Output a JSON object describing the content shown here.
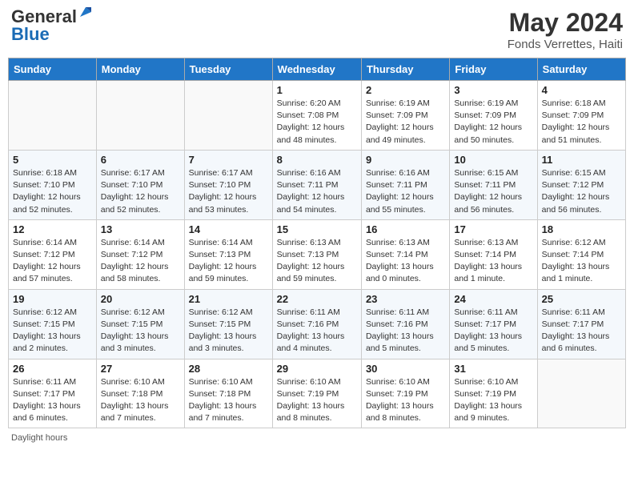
{
  "logo": {
    "general": "General",
    "blue": "Blue"
  },
  "header": {
    "month": "May 2024",
    "location": "Fonds Verrettes, Haiti"
  },
  "weekdays": [
    "Sunday",
    "Monday",
    "Tuesday",
    "Wednesday",
    "Thursday",
    "Friday",
    "Saturday"
  ],
  "weeks": [
    [
      {
        "day": "",
        "sunrise": "",
        "sunset": "",
        "daylight": ""
      },
      {
        "day": "",
        "sunrise": "",
        "sunset": "",
        "daylight": ""
      },
      {
        "day": "",
        "sunrise": "",
        "sunset": "",
        "daylight": ""
      },
      {
        "day": "1",
        "sunrise": "Sunrise: 6:20 AM",
        "sunset": "Sunset: 7:08 PM",
        "daylight": "Daylight: 12 hours and 48 minutes."
      },
      {
        "day": "2",
        "sunrise": "Sunrise: 6:19 AM",
        "sunset": "Sunset: 7:09 PM",
        "daylight": "Daylight: 12 hours and 49 minutes."
      },
      {
        "day": "3",
        "sunrise": "Sunrise: 6:19 AM",
        "sunset": "Sunset: 7:09 PM",
        "daylight": "Daylight: 12 hours and 50 minutes."
      },
      {
        "day": "4",
        "sunrise": "Sunrise: 6:18 AM",
        "sunset": "Sunset: 7:09 PM",
        "daylight": "Daylight: 12 hours and 51 minutes."
      }
    ],
    [
      {
        "day": "5",
        "sunrise": "Sunrise: 6:18 AM",
        "sunset": "Sunset: 7:10 PM",
        "daylight": "Daylight: 12 hours and 52 minutes."
      },
      {
        "day": "6",
        "sunrise": "Sunrise: 6:17 AM",
        "sunset": "Sunset: 7:10 PM",
        "daylight": "Daylight: 12 hours and 52 minutes."
      },
      {
        "day": "7",
        "sunrise": "Sunrise: 6:17 AM",
        "sunset": "Sunset: 7:10 PM",
        "daylight": "Daylight: 12 hours and 53 minutes."
      },
      {
        "day": "8",
        "sunrise": "Sunrise: 6:16 AM",
        "sunset": "Sunset: 7:11 PM",
        "daylight": "Daylight: 12 hours and 54 minutes."
      },
      {
        "day": "9",
        "sunrise": "Sunrise: 6:16 AM",
        "sunset": "Sunset: 7:11 PM",
        "daylight": "Daylight: 12 hours and 55 minutes."
      },
      {
        "day": "10",
        "sunrise": "Sunrise: 6:15 AM",
        "sunset": "Sunset: 7:11 PM",
        "daylight": "Daylight: 12 hours and 56 minutes."
      },
      {
        "day": "11",
        "sunrise": "Sunrise: 6:15 AM",
        "sunset": "Sunset: 7:12 PM",
        "daylight": "Daylight: 12 hours and 56 minutes."
      }
    ],
    [
      {
        "day": "12",
        "sunrise": "Sunrise: 6:14 AM",
        "sunset": "Sunset: 7:12 PM",
        "daylight": "Daylight: 12 hours and 57 minutes."
      },
      {
        "day": "13",
        "sunrise": "Sunrise: 6:14 AM",
        "sunset": "Sunset: 7:12 PM",
        "daylight": "Daylight: 12 hours and 58 minutes."
      },
      {
        "day": "14",
        "sunrise": "Sunrise: 6:14 AM",
        "sunset": "Sunset: 7:13 PM",
        "daylight": "Daylight: 12 hours and 59 minutes."
      },
      {
        "day": "15",
        "sunrise": "Sunrise: 6:13 AM",
        "sunset": "Sunset: 7:13 PM",
        "daylight": "Daylight: 12 hours and 59 minutes."
      },
      {
        "day": "16",
        "sunrise": "Sunrise: 6:13 AM",
        "sunset": "Sunset: 7:14 PM",
        "daylight": "Daylight: 13 hours and 0 minutes."
      },
      {
        "day": "17",
        "sunrise": "Sunrise: 6:13 AM",
        "sunset": "Sunset: 7:14 PM",
        "daylight": "Daylight: 13 hours and 1 minute."
      },
      {
        "day": "18",
        "sunrise": "Sunrise: 6:12 AM",
        "sunset": "Sunset: 7:14 PM",
        "daylight": "Daylight: 13 hours and 1 minute."
      }
    ],
    [
      {
        "day": "19",
        "sunrise": "Sunrise: 6:12 AM",
        "sunset": "Sunset: 7:15 PM",
        "daylight": "Daylight: 13 hours and 2 minutes."
      },
      {
        "day": "20",
        "sunrise": "Sunrise: 6:12 AM",
        "sunset": "Sunset: 7:15 PM",
        "daylight": "Daylight: 13 hours and 3 minutes."
      },
      {
        "day": "21",
        "sunrise": "Sunrise: 6:12 AM",
        "sunset": "Sunset: 7:15 PM",
        "daylight": "Daylight: 13 hours and 3 minutes."
      },
      {
        "day": "22",
        "sunrise": "Sunrise: 6:11 AM",
        "sunset": "Sunset: 7:16 PM",
        "daylight": "Daylight: 13 hours and 4 minutes."
      },
      {
        "day": "23",
        "sunrise": "Sunrise: 6:11 AM",
        "sunset": "Sunset: 7:16 PM",
        "daylight": "Daylight: 13 hours and 5 minutes."
      },
      {
        "day": "24",
        "sunrise": "Sunrise: 6:11 AM",
        "sunset": "Sunset: 7:17 PM",
        "daylight": "Daylight: 13 hours and 5 minutes."
      },
      {
        "day": "25",
        "sunrise": "Sunrise: 6:11 AM",
        "sunset": "Sunset: 7:17 PM",
        "daylight": "Daylight: 13 hours and 6 minutes."
      }
    ],
    [
      {
        "day": "26",
        "sunrise": "Sunrise: 6:11 AM",
        "sunset": "Sunset: 7:17 PM",
        "daylight": "Daylight: 13 hours and 6 minutes."
      },
      {
        "day": "27",
        "sunrise": "Sunrise: 6:10 AM",
        "sunset": "Sunset: 7:18 PM",
        "daylight": "Daylight: 13 hours and 7 minutes."
      },
      {
        "day": "28",
        "sunrise": "Sunrise: 6:10 AM",
        "sunset": "Sunset: 7:18 PM",
        "daylight": "Daylight: 13 hours and 7 minutes."
      },
      {
        "day": "29",
        "sunrise": "Sunrise: 6:10 AM",
        "sunset": "Sunset: 7:19 PM",
        "daylight": "Daylight: 13 hours and 8 minutes."
      },
      {
        "day": "30",
        "sunrise": "Sunrise: 6:10 AM",
        "sunset": "Sunset: 7:19 PM",
        "daylight": "Daylight: 13 hours and 8 minutes."
      },
      {
        "day": "31",
        "sunrise": "Sunrise: 6:10 AM",
        "sunset": "Sunset: 7:19 PM",
        "daylight": "Daylight: 13 hours and 9 minutes."
      },
      {
        "day": "",
        "sunrise": "",
        "sunset": "",
        "daylight": ""
      }
    ]
  ],
  "footer": {
    "daylight_label": "Daylight hours"
  }
}
